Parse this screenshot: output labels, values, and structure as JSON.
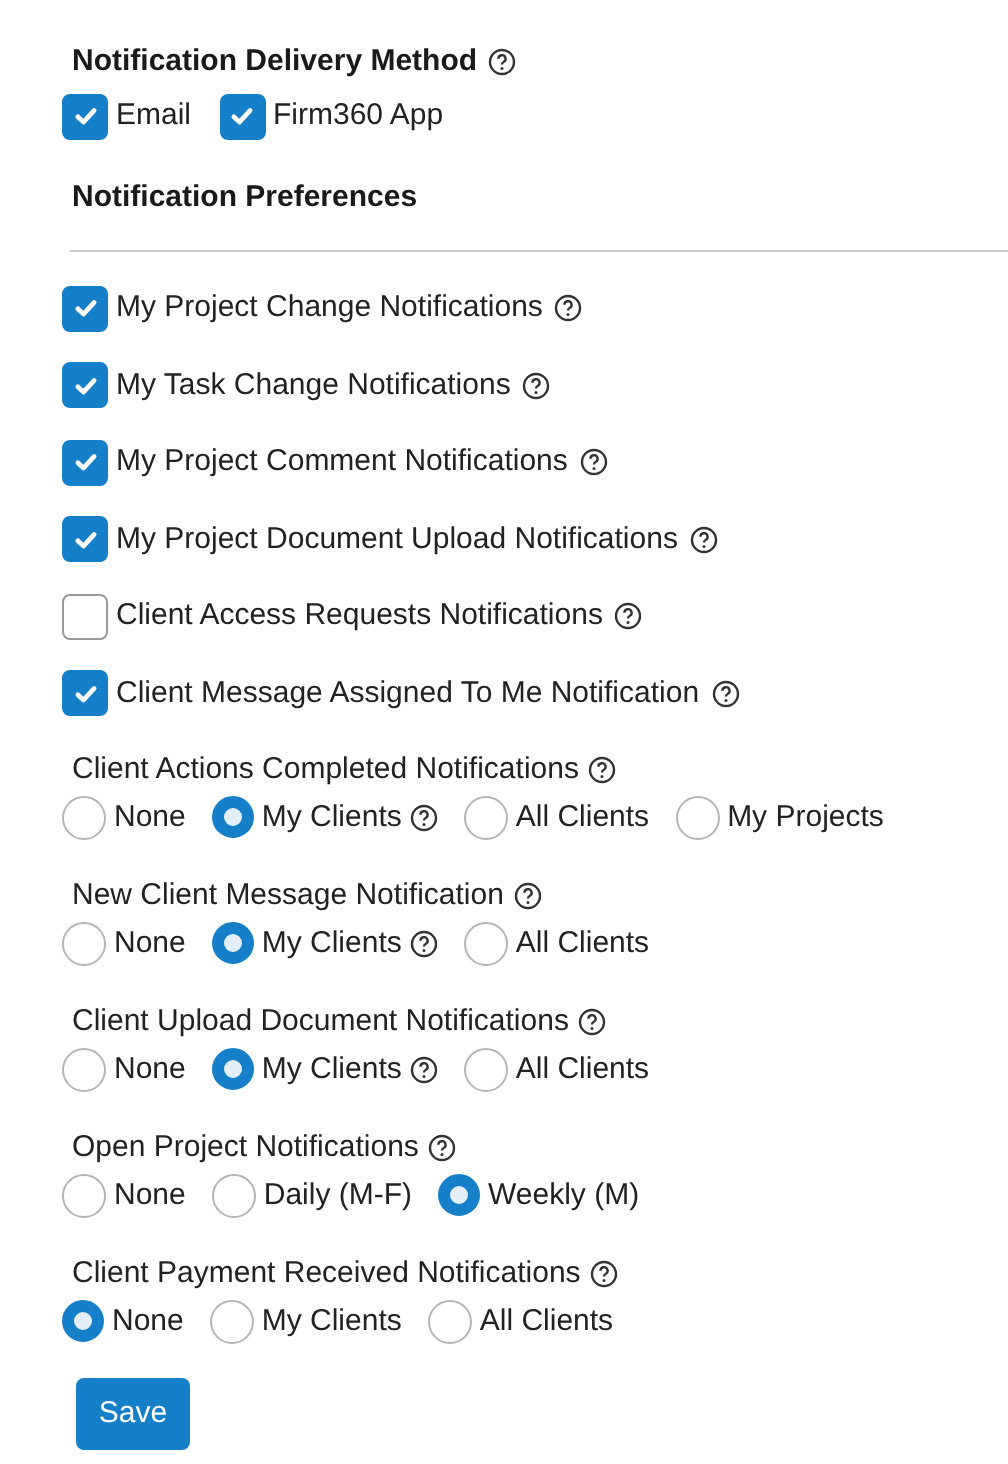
{
  "delivery": {
    "title": "Notification Delivery Method",
    "help": true,
    "options": [
      {
        "label": "Email",
        "checked": true
      },
      {
        "label": "Firm360 App",
        "checked": true
      }
    ]
  },
  "preferences_title": "Notification Preferences",
  "checkboxes": [
    {
      "label": "My Project Change Notifications",
      "checked": true,
      "help": true
    },
    {
      "label": "My Task Change Notifications",
      "checked": true,
      "help": true
    },
    {
      "label": "My Project Comment Notifications",
      "checked": true,
      "help": true
    },
    {
      "label": "My Project Document Upload Notifications",
      "checked": true,
      "help": true
    },
    {
      "label": "Client Access Requests Notifications",
      "checked": false,
      "help": true
    },
    {
      "label": "Client Message Assigned To Me Notification",
      "checked": true,
      "help": true
    }
  ],
  "radio_groups": [
    {
      "label": "Client Actions Completed Notifications",
      "help": true,
      "options": [
        {
          "label": "None",
          "selected": false,
          "help": false
        },
        {
          "label": "My Clients",
          "selected": true,
          "help": true
        },
        {
          "label": "All Clients",
          "selected": false,
          "help": false
        },
        {
          "label": "My Projects",
          "selected": false,
          "help": false
        }
      ]
    },
    {
      "label": "New Client Message Notification",
      "help": true,
      "options": [
        {
          "label": "None",
          "selected": false,
          "help": false
        },
        {
          "label": "My Clients",
          "selected": true,
          "help": true
        },
        {
          "label": "All Clients",
          "selected": false,
          "help": false
        }
      ]
    },
    {
      "label": "Client Upload Document Notifications",
      "help": true,
      "options": [
        {
          "label": "None",
          "selected": false,
          "help": false
        },
        {
          "label": "My Clients",
          "selected": true,
          "help": true
        },
        {
          "label": "All Clients",
          "selected": false,
          "help": false
        }
      ]
    },
    {
      "label": "Open Project Notifications",
      "help": true,
      "options": [
        {
          "label": "None",
          "selected": false,
          "help": false
        },
        {
          "label": "Daily (M-F)",
          "selected": false,
          "help": false
        },
        {
          "label": "Weekly (M)",
          "selected": true,
          "help": false
        }
      ]
    },
    {
      "label": "Client Payment Received Notifications",
      "help": true,
      "options": [
        {
          "label": "None",
          "selected": true,
          "help": false
        },
        {
          "label": "My Clients",
          "selected": false,
          "help": false
        },
        {
          "label": "All Clients",
          "selected": false,
          "help": false
        }
      ]
    }
  ],
  "save_button": "Save"
}
